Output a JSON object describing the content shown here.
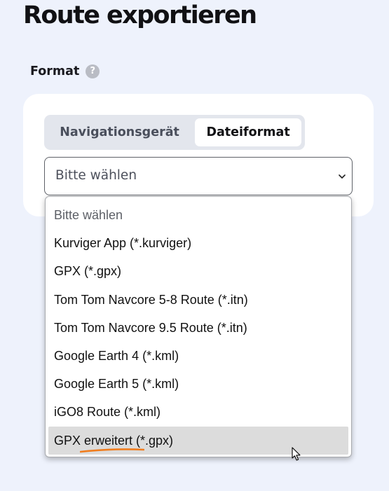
{
  "page": {
    "title": "Route exportieren"
  },
  "format_section": {
    "label": "Format",
    "help_icon": "?"
  },
  "tabs": [
    {
      "label": "Navigationsgerät",
      "active": false
    },
    {
      "label": "Dateiformat",
      "active": true
    }
  ],
  "select": {
    "selected_value": "Bitte wählen",
    "icon": "chevron-down-icon"
  },
  "dropdown": {
    "options": [
      {
        "label": "Bitte wählen"
      },
      {
        "label": "Kurviger App (*.kurviger)"
      },
      {
        "label": "GPX (*.gpx)"
      },
      {
        "label": "Tom Tom Navcore 5-8 Route (*.itn)"
      },
      {
        "label": "Tom Tom Navcore 9.5 Route (*.itn)"
      },
      {
        "label": "Google Earth 4 (*.kml)"
      },
      {
        "label": "Google Earth 5 (*.kml)"
      },
      {
        "label": "iGO8 Route (*.kml)"
      },
      {
        "label": "GPX erweitert (*.gpx)"
      }
    ],
    "highlighted_index": 8
  },
  "colors": {
    "page_background": "#eef2fc",
    "card_background": "#ffffff",
    "segment_track": "#e3e6ed",
    "highlight_row": "#dcdcdc",
    "spellcheck_underline": "#f07d1e"
  }
}
